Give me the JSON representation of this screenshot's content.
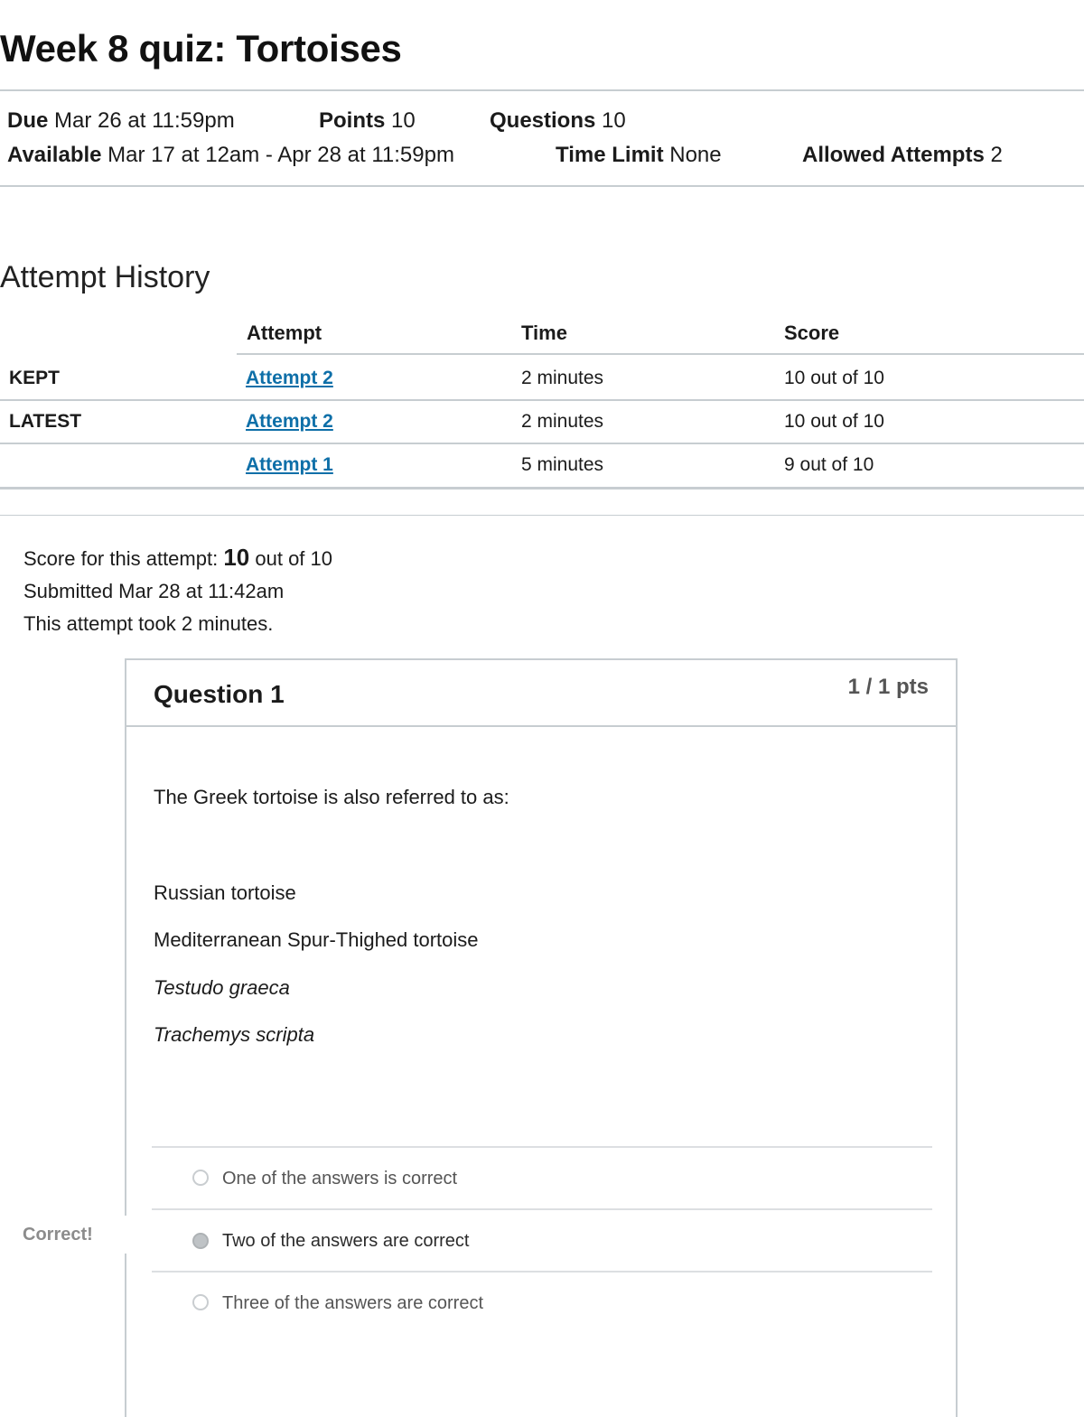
{
  "page_title": "Week 8 quiz: Tortoises",
  "meta": {
    "due_label": "Due",
    "due_value": "Mar 26 at 11:59pm",
    "points_label": "Points",
    "points_value": "10",
    "questions_label": "Questions",
    "questions_value": "10",
    "available_label": "Available",
    "available_value": "Mar 17 at 12am - Apr 28 at 11:59pm",
    "time_limit_label": "Time Limit",
    "time_limit_value": "None",
    "allowed_attempts_label": "Allowed Attempts",
    "allowed_attempts_value": "2"
  },
  "attempt_history": {
    "title": "Attempt History",
    "headers": [
      "Attempt",
      "Time",
      "Score"
    ],
    "rows": [
      {
        "label": "KEPT",
        "attempt": "Attempt 2",
        "time": "2 minutes",
        "score": "10 out of 10"
      },
      {
        "label": "LATEST",
        "attempt": "Attempt 2",
        "time": "2 minutes",
        "score": "10 out of 10"
      },
      {
        "label": "",
        "attempt": "Attempt 1",
        "time": "5 minutes",
        "score": "9 out of 10"
      }
    ]
  },
  "summary": {
    "score_prefix": "Score for this attempt:",
    "score_value": "10",
    "score_suffix": "out of 10",
    "submitted": "Submitted Mar 28 at 11:42am",
    "duration": "This attempt took 2 minutes."
  },
  "question": {
    "title": "Question 1",
    "points": "1 / 1 pts",
    "prompt": "The Greek tortoise is also referred to as:",
    "items": [
      "Russian tortoise",
      "Mediterranean Spur-Thighed tortoise",
      "Testudo graeca",
      "Trachemys scripta"
    ],
    "answers": [
      {
        "text": "One of the answers is correct",
        "selected": false
      },
      {
        "text": "Two of the answers are correct",
        "selected": true
      },
      {
        "text": "Three of the answers are correct",
        "selected": false
      }
    ],
    "correct_flag": "Correct!"
  }
}
